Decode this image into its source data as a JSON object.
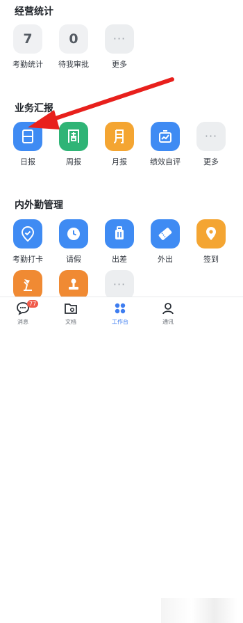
{
  "sections": {
    "business_stats": {
      "title": "经营统计",
      "items": [
        {
          "label": "考勤统计",
          "value": "7"
        },
        {
          "label": "待我审批",
          "value": "0"
        },
        {
          "label": "更多",
          "value": "···"
        }
      ]
    },
    "business_report": {
      "title": "业务汇报",
      "items": [
        {
          "label": "日报",
          "glyph": "日",
          "icon": "daily-report-icon"
        },
        {
          "label": "周报",
          "glyph": "周",
          "icon": "weekly-report-icon"
        },
        {
          "label": "月报",
          "glyph": "月",
          "icon": "monthly-report-icon"
        },
        {
          "label": "绩效自评",
          "icon": "performance-chart-icon"
        },
        {
          "label": "更多",
          "glyph": "···",
          "icon": "more-icon"
        }
      ]
    },
    "attendance": {
      "title": "内外勤管理",
      "items": [
        {
          "label": "考勤打卡",
          "icon": "checkin-shield-icon"
        },
        {
          "label": "请假",
          "icon": "clock-icon"
        },
        {
          "label": "出差",
          "icon": "luggage-icon"
        },
        {
          "label": "外出",
          "icon": "ticket-icon"
        },
        {
          "label": "签到",
          "icon": "location-pin-icon"
        }
      ],
      "row2_more": "···"
    }
  },
  "bottom_nav": {
    "tabs": [
      {
        "label": "消息",
        "icon": "chat-icon",
        "badge": "77"
      },
      {
        "label": "文档",
        "icon": "folder-icon"
      },
      {
        "label": "工作台",
        "icon": "grid-icon",
        "active": true
      },
      {
        "label": "通讯",
        "icon": "contacts-icon"
      }
    ]
  },
  "colors": {
    "blue": "#3f8bf3",
    "green": "#2fb476",
    "orange": "#f4a532",
    "deep_orange": "#f08a33",
    "arrow_red": "#e8201c",
    "active_tab": "#3e7df0"
  }
}
